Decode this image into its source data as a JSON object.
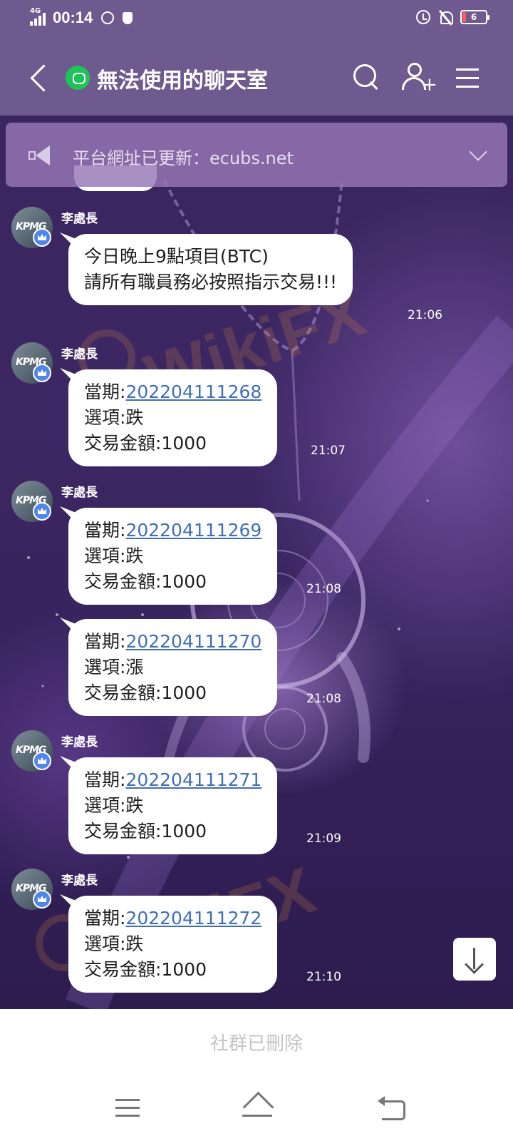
{
  "status_bar": {
    "network": "4G",
    "time": "00:14",
    "battery_level": "6",
    "icons": [
      "signal-icon",
      "vpn-icon",
      "shield-icon",
      "alarm-icon",
      "bell-off-icon",
      "battery-icon"
    ]
  },
  "header": {
    "title": "無法使用的聊天室",
    "icons": [
      "back-arrow-icon",
      "chat-badge-icon",
      "search-icon",
      "add-user-icon",
      "menu-icon"
    ]
  },
  "notice": {
    "text": "平台網址已更新：ecubs.net",
    "icons": [
      "megaphone-icon",
      "chevron-down-icon"
    ]
  },
  "messages": [
    {
      "sender": "李處長",
      "lines": [
        "今日晚上9點項目(BTC)",
        "請所有職員務必按照指示交易!!!"
      ],
      "time": "21:06"
    },
    {
      "sender": "李處長",
      "period_label": "當期:",
      "period": "202204111268",
      "option": "選項:跌",
      "amount": "交易金額:1000",
      "time": "21:07"
    },
    {
      "sender": "李處長",
      "period_label": "當期:",
      "period": "202204111269",
      "option": "選項:跌",
      "amount": "交易金額:1000",
      "time": "21:08"
    },
    {
      "sender": "",
      "period_label": "當期:",
      "period": "202204111270",
      "option": "選項:漲",
      "amount": "交易金額:1000",
      "time": "21:08"
    },
    {
      "sender": "李處長",
      "period_label": "當期:",
      "period": "202204111271",
      "option": "選項:跌",
      "amount": "交易金額:1000",
      "time": "21:09"
    },
    {
      "sender": "李處長",
      "period_label": "當期:",
      "period": "202204111272",
      "option": "選項:跌",
      "amount": "交易金額:1000",
      "time": "21:10"
    }
  ],
  "avatar": {
    "logo_text": "KPMG",
    "badge_color": "#4f86e8"
  },
  "watermark": "WikiFX",
  "footer": {
    "text": "社群已刪除"
  },
  "colors": {
    "header": "#6e5a8e",
    "link": "#3f6fb9",
    "background": "#3a2558"
  },
  "nav_icons": [
    "recent-apps-icon",
    "home-icon",
    "back-icon"
  ]
}
